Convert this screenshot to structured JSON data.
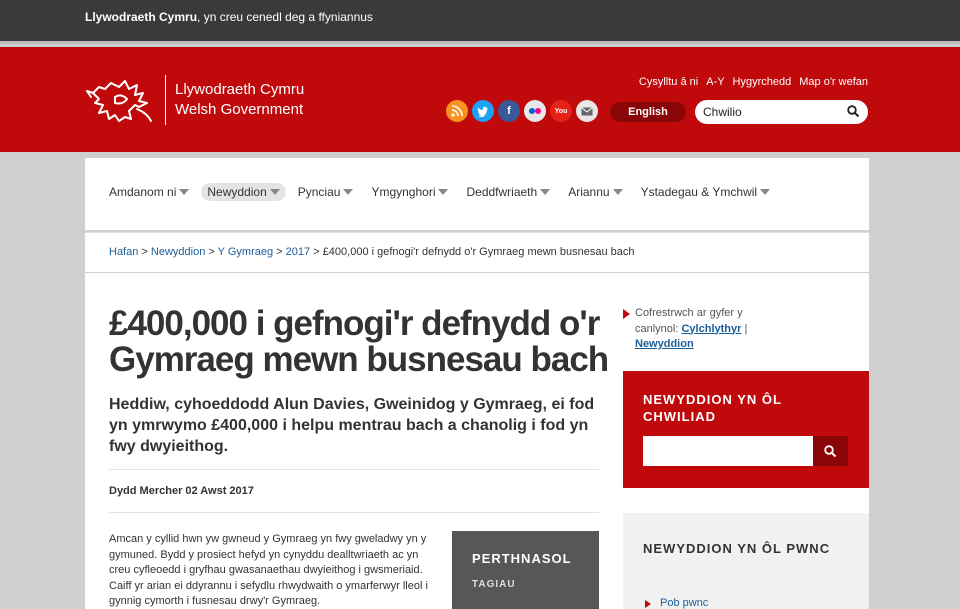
{
  "topbar": {
    "brand": "Llywodraeth Cymru",
    "tagline": ", yn creu cenedl deg a ffyniannus"
  },
  "header": {
    "logo_line1": "Llywodraeth Cymru",
    "logo_line2": "Welsh Government",
    "utility_links": [
      "Cysylltu â ni",
      "A-Y",
      "Hygyrchedd",
      "Map o'r wefan"
    ],
    "social_icons": [
      "rss-icon",
      "twitter-icon",
      "facebook-icon",
      "flickr-icon",
      "youtube-icon",
      "email-icon"
    ],
    "language_button": "English",
    "search_value": "Chwilio"
  },
  "nav": {
    "items": [
      "Amdanom ni",
      "Newyddion",
      "Pynciau",
      "Ymgynghori",
      "Deddfwriaeth",
      "Ariannu",
      "Ystadegau & Ymchwil"
    ],
    "active_index": 1
  },
  "breadcrumb": {
    "items": [
      "Hafan",
      "Newyddion",
      "Y Gymraeg",
      "2017"
    ],
    "separator": " > ",
    "current": "£400,000 i gefnogi'r defnydd o'r Gymraeg mewn busnesau bach"
  },
  "article": {
    "title": "£400,000 i gefnogi'r defnydd o'r Gymraeg mewn busnesau bach",
    "lead": "Heddiw, cyhoeddodd Alun Davies, Gweinidog y Gymraeg, ei fod yn ymrwymo £400,000 i helpu mentrau bach a chanolig i fod yn fwy dwyieithog.",
    "date": "Dydd Mercher 02 Awst 2017",
    "body": "Amcan y cyllid hwn yw gwneud y Gymraeg yn fwy gweladwy yn y gymuned. Bydd y prosiect hefyd yn cynyddu dealltwriaeth ac yn creu cyfleoedd i gryfhau gwasanaethau dwyieithog i gwsmeriaid. Caiff yr arian ei ddyrannu i sefydlu rhwydwaith o ymarferwyr lleol i gynnig cymorth i fusnesau drwy'r Gymraeg."
  },
  "related": {
    "title": "PERTHNASOL",
    "subtitle": "TAGIAU"
  },
  "sidebar": {
    "subscribe_text": "Cofrestrwch ar gyfer y canlynol:",
    "subscribe_link1": "Cylchlythyr",
    "subscribe_sep": " | ",
    "subscribe_link2": "Newyddion",
    "news_search_title": "NEWYDDION YN ÔL CHWILIAD",
    "news_by_topic_title": "NEWYDDION YN ÔL PWNC",
    "topic_link": "Pob pwnc"
  },
  "colors": {
    "brand_red": "#c0090b",
    "dark_red": "#8a0508",
    "link_blue": "#1a5e9a",
    "topbar": "#3a3a3a"
  }
}
